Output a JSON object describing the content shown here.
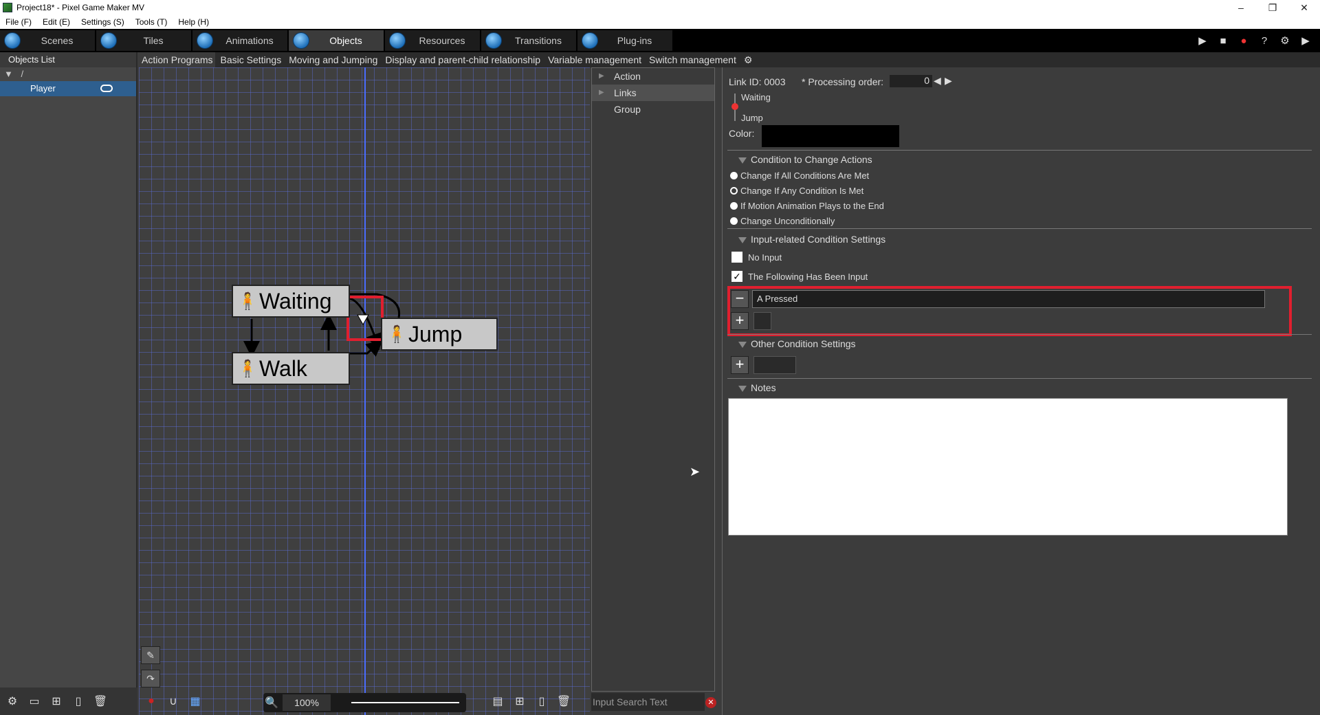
{
  "window": {
    "title": "Project18* - Pixel Game Maker MV",
    "minimize": "–",
    "maximize": "❐",
    "close": "✕"
  },
  "menu": [
    "File (F)",
    "Edit (E)",
    "Settings (S)",
    "Tools (T)",
    "Help (H)"
  ],
  "tabs": [
    "Scenes",
    "Tiles",
    "Animations",
    "Objects",
    "Resources",
    "Transitions",
    "Plug-ins"
  ],
  "active_tab": "Objects",
  "objects_list": {
    "header": "Objects List",
    "root": "/",
    "items": [
      "Player"
    ]
  },
  "subtabs": [
    "Action Programs",
    "Basic Settings",
    "Moving and Jumping",
    "Display and parent-child relationship",
    "Variable management",
    "Switch management"
  ],
  "graph": {
    "nodes": [
      "Waiting",
      "Walk",
      "Jump"
    ]
  },
  "zoom": "100%",
  "middle_panel": {
    "items": [
      "Action",
      "Links",
      "Group"
    ],
    "search_placeholder": "Input Search Text"
  },
  "link": {
    "id_label": "Link ID: 0003",
    "processing_label": "* Processing order:",
    "processing_value": "0",
    "from": "Waiting",
    "to": "Jump",
    "color_label": "Color:",
    "color_value": "#000000"
  },
  "condition_change": {
    "title": "Condition to Change Actions",
    "options": [
      "Change If All Conditions Are Met",
      "Change If Any Condition Is Met",
      "If Motion Animation Plays to the End",
      "Change Unconditionally"
    ]
  },
  "input_conditions": {
    "title": "Input-related Condition Settings",
    "no_input": "No Input",
    "following_input": "The Following Has Been Input",
    "inputs": [
      "A Pressed"
    ]
  },
  "other_conditions": {
    "title": "Other Condition Settings"
  },
  "notes": {
    "title": "Notes",
    "text": ""
  }
}
